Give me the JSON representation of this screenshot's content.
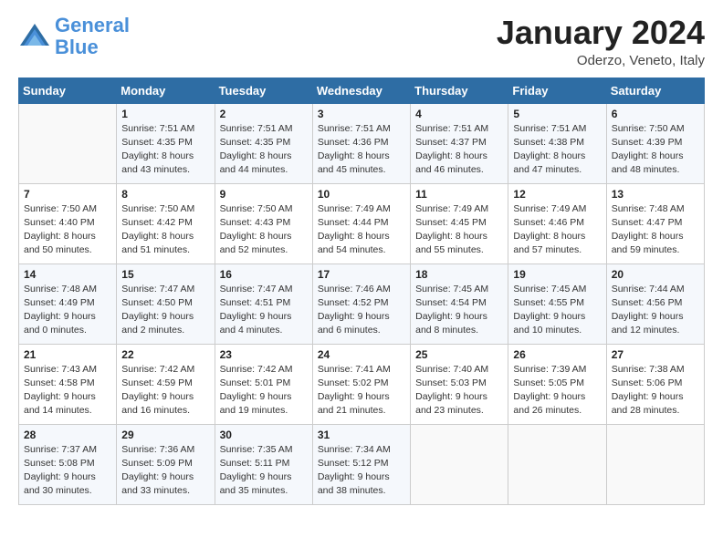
{
  "header": {
    "logo_line1": "General",
    "logo_line2": "Blue",
    "month_title": "January 2024",
    "subtitle": "Oderzo, Veneto, Italy"
  },
  "weekdays": [
    "Sunday",
    "Monday",
    "Tuesday",
    "Wednesday",
    "Thursday",
    "Friday",
    "Saturday"
  ],
  "weeks": [
    [
      {
        "day": "",
        "sunrise": "",
        "sunset": "",
        "daylight": ""
      },
      {
        "day": "1",
        "sunrise": "Sunrise: 7:51 AM",
        "sunset": "Sunset: 4:35 PM",
        "daylight": "Daylight: 8 hours and 43 minutes."
      },
      {
        "day": "2",
        "sunrise": "Sunrise: 7:51 AM",
        "sunset": "Sunset: 4:35 PM",
        "daylight": "Daylight: 8 hours and 44 minutes."
      },
      {
        "day": "3",
        "sunrise": "Sunrise: 7:51 AM",
        "sunset": "Sunset: 4:36 PM",
        "daylight": "Daylight: 8 hours and 45 minutes."
      },
      {
        "day": "4",
        "sunrise": "Sunrise: 7:51 AM",
        "sunset": "Sunset: 4:37 PM",
        "daylight": "Daylight: 8 hours and 46 minutes."
      },
      {
        "day": "5",
        "sunrise": "Sunrise: 7:51 AM",
        "sunset": "Sunset: 4:38 PM",
        "daylight": "Daylight: 8 hours and 47 minutes."
      },
      {
        "day": "6",
        "sunrise": "Sunrise: 7:50 AM",
        "sunset": "Sunset: 4:39 PM",
        "daylight": "Daylight: 8 hours and 48 minutes."
      }
    ],
    [
      {
        "day": "7",
        "sunrise": "Sunrise: 7:50 AM",
        "sunset": "Sunset: 4:40 PM",
        "daylight": "Daylight: 8 hours and 50 minutes."
      },
      {
        "day": "8",
        "sunrise": "Sunrise: 7:50 AM",
        "sunset": "Sunset: 4:42 PM",
        "daylight": "Daylight: 8 hours and 51 minutes."
      },
      {
        "day": "9",
        "sunrise": "Sunrise: 7:50 AM",
        "sunset": "Sunset: 4:43 PM",
        "daylight": "Daylight: 8 hours and 52 minutes."
      },
      {
        "day": "10",
        "sunrise": "Sunrise: 7:49 AM",
        "sunset": "Sunset: 4:44 PM",
        "daylight": "Daylight: 8 hours and 54 minutes."
      },
      {
        "day": "11",
        "sunrise": "Sunrise: 7:49 AM",
        "sunset": "Sunset: 4:45 PM",
        "daylight": "Daylight: 8 hours and 55 minutes."
      },
      {
        "day": "12",
        "sunrise": "Sunrise: 7:49 AM",
        "sunset": "Sunset: 4:46 PM",
        "daylight": "Daylight: 8 hours and 57 minutes."
      },
      {
        "day": "13",
        "sunrise": "Sunrise: 7:48 AM",
        "sunset": "Sunset: 4:47 PM",
        "daylight": "Daylight: 8 hours and 59 minutes."
      }
    ],
    [
      {
        "day": "14",
        "sunrise": "Sunrise: 7:48 AM",
        "sunset": "Sunset: 4:49 PM",
        "daylight": "Daylight: 9 hours and 0 minutes."
      },
      {
        "day": "15",
        "sunrise": "Sunrise: 7:47 AM",
        "sunset": "Sunset: 4:50 PM",
        "daylight": "Daylight: 9 hours and 2 minutes."
      },
      {
        "day": "16",
        "sunrise": "Sunrise: 7:47 AM",
        "sunset": "Sunset: 4:51 PM",
        "daylight": "Daylight: 9 hours and 4 minutes."
      },
      {
        "day": "17",
        "sunrise": "Sunrise: 7:46 AM",
        "sunset": "Sunset: 4:52 PM",
        "daylight": "Daylight: 9 hours and 6 minutes."
      },
      {
        "day": "18",
        "sunrise": "Sunrise: 7:45 AM",
        "sunset": "Sunset: 4:54 PM",
        "daylight": "Daylight: 9 hours and 8 minutes."
      },
      {
        "day": "19",
        "sunrise": "Sunrise: 7:45 AM",
        "sunset": "Sunset: 4:55 PM",
        "daylight": "Daylight: 9 hours and 10 minutes."
      },
      {
        "day": "20",
        "sunrise": "Sunrise: 7:44 AM",
        "sunset": "Sunset: 4:56 PM",
        "daylight": "Daylight: 9 hours and 12 minutes."
      }
    ],
    [
      {
        "day": "21",
        "sunrise": "Sunrise: 7:43 AM",
        "sunset": "Sunset: 4:58 PM",
        "daylight": "Daylight: 9 hours and 14 minutes."
      },
      {
        "day": "22",
        "sunrise": "Sunrise: 7:42 AM",
        "sunset": "Sunset: 4:59 PM",
        "daylight": "Daylight: 9 hours and 16 minutes."
      },
      {
        "day": "23",
        "sunrise": "Sunrise: 7:42 AM",
        "sunset": "Sunset: 5:01 PM",
        "daylight": "Daylight: 9 hours and 19 minutes."
      },
      {
        "day": "24",
        "sunrise": "Sunrise: 7:41 AM",
        "sunset": "Sunset: 5:02 PM",
        "daylight": "Daylight: 9 hours and 21 minutes."
      },
      {
        "day": "25",
        "sunrise": "Sunrise: 7:40 AM",
        "sunset": "Sunset: 5:03 PM",
        "daylight": "Daylight: 9 hours and 23 minutes."
      },
      {
        "day": "26",
        "sunrise": "Sunrise: 7:39 AM",
        "sunset": "Sunset: 5:05 PM",
        "daylight": "Daylight: 9 hours and 26 minutes."
      },
      {
        "day": "27",
        "sunrise": "Sunrise: 7:38 AM",
        "sunset": "Sunset: 5:06 PM",
        "daylight": "Daylight: 9 hours and 28 minutes."
      }
    ],
    [
      {
        "day": "28",
        "sunrise": "Sunrise: 7:37 AM",
        "sunset": "Sunset: 5:08 PM",
        "daylight": "Daylight: 9 hours and 30 minutes."
      },
      {
        "day": "29",
        "sunrise": "Sunrise: 7:36 AM",
        "sunset": "Sunset: 5:09 PM",
        "daylight": "Daylight: 9 hours and 33 minutes."
      },
      {
        "day": "30",
        "sunrise": "Sunrise: 7:35 AM",
        "sunset": "Sunset: 5:11 PM",
        "daylight": "Daylight: 9 hours and 35 minutes."
      },
      {
        "day": "31",
        "sunrise": "Sunrise: 7:34 AM",
        "sunset": "Sunset: 5:12 PM",
        "daylight": "Daylight: 9 hours and 38 minutes."
      },
      {
        "day": "",
        "sunrise": "",
        "sunset": "",
        "daylight": ""
      },
      {
        "day": "",
        "sunrise": "",
        "sunset": "",
        "daylight": ""
      },
      {
        "day": "",
        "sunrise": "",
        "sunset": "",
        "daylight": ""
      }
    ]
  ]
}
